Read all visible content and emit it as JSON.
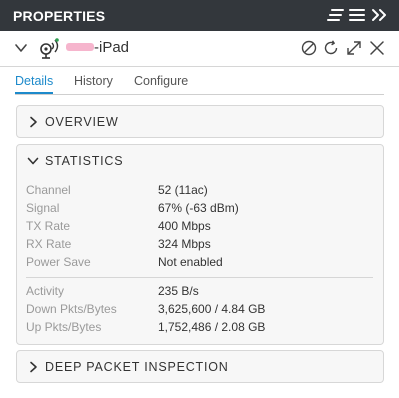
{
  "panel": {
    "title": "PROPERTIES",
    "controls": [
      "list-align-icon",
      "menu-icon",
      "collapse-double-chevron-icon"
    ]
  },
  "device": {
    "icon": "wireless-client-icon",
    "name_suffix": "-iPad",
    "actions": [
      "block-icon",
      "reconnect-icon",
      "expand-icon",
      "close-icon"
    ]
  },
  "tabs": [
    {
      "label": "Details",
      "active": true
    },
    {
      "label": "History",
      "active": false
    },
    {
      "label": "Configure",
      "active": false
    }
  ],
  "sections": {
    "overview": {
      "title": "OVERVIEW",
      "expanded": false
    },
    "statistics": {
      "title": "STATISTICS",
      "expanded": true,
      "group1": [
        {
          "label": "Channel",
          "value": "52 (11ac)"
        },
        {
          "label": "Signal",
          "value": "67% (-63 dBm)"
        },
        {
          "label": "TX Rate",
          "value": "400 Mbps"
        },
        {
          "label": "RX Rate",
          "value": "324 Mbps"
        },
        {
          "label": "Power Save",
          "value": "Not enabled"
        }
      ],
      "group2": [
        {
          "label": "Activity",
          "value": "235 B/s"
        },
        {
          "label": "Down Pkts/Bytes",
          "value": "3,625,600 / 4.84 GB"
        },
        {
          "label": "Up Pkts/Bytes",
          "value": "1,752,486 / 2.08 GB"
        }
      ]
    },
    "dpi": {
      "title": "DEEP PACKET INSPECTION",
      "expanded": false
    }
  },
  "colors": {
    "titlebar_bg": "#33373c",
    "accent": "#1d8acb",
    "label_gray": "#9a9a9a",
    "section_bg": "#f7f7f7"
  }
}
